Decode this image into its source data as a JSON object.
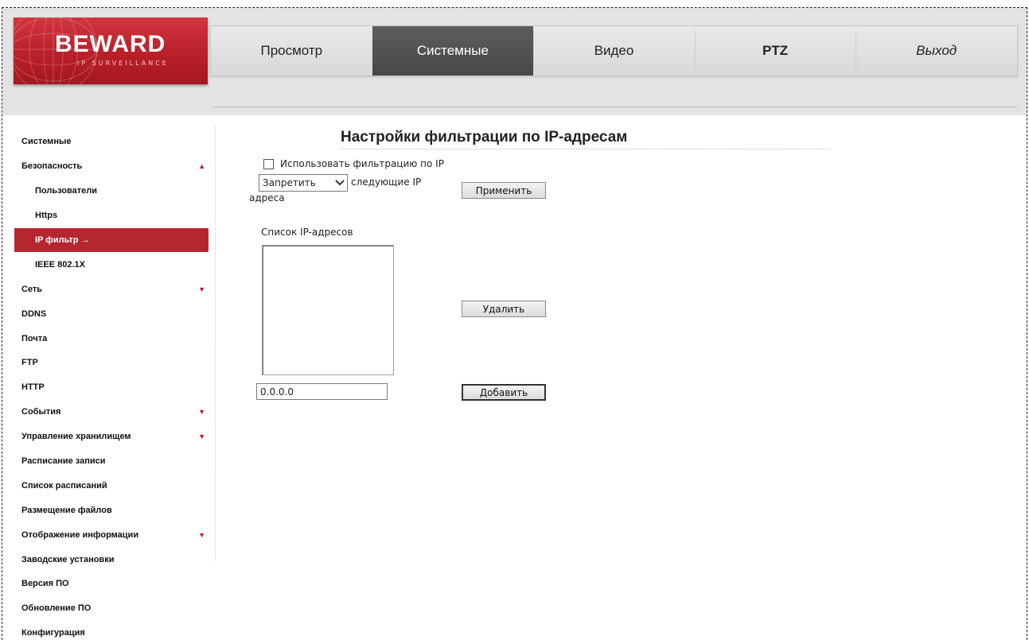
{
  "brand": {
    "name": "BEWARD",
    "tagline": "IP SURVEILLANCE"
  },
  "nav": {
    "items": [
      {
        "label": "Просмотр"
      },
      {
        "label": "Системные",
        "active": true
      },
      {
        "label": "Видео"
      },
      {
        "label": "PTZ"
      },
      {
        "label": "Выход"
      }
    ]
  },
  "sidebar": {
    "items": [
      {
        "label": "Системные"
      },
      {
        "label": "Безопасность",
        "arrow": "▲"
      },
      {
        "label": "Пользователи",
        "sub": true
      },
      {
        "label": "Https",
        "sub": true
      },
      {
        "label": "IP фильтр →",
        "sub": true,
        "active": true
      },
      {
        "label": "IEEE 802.1X",
        "sub": true
      },
      {
        "label": "Сеть",
        "arrow": "▼"
      },
      {
        "label": "DDNS"
      },
      {
        "label": "Почта"
      },
      {
        "label": "FTP"
      },
      {
        "label": "HTTP"
      },
      {
        "label": "События",
        "arrow": "▼"
      },
      {
        "label": "Управление хранилищем",
        "arrow": "▼"
      },
      {
        "label": "Расписание записи"
      },
      {
        "label": "Список расписаний"
      },
      {
        "label": "Размещение файлов"
      },
      {
        "label": "Отображение информации",
        "arrow": "▼"
      },
      {
        "label": "Заводские установки"
      },
      {
        "label": "Версия ПО"
      },
      {
        "label": "Обновление ПО"
      },
      {
        "label": "Конфигурация"
      }
    ]
  },
  "content": {
    "title": "Настройки фильтрации по IP-адресам",
    "use_filter_label": "Использовать фильтрацию по IP",
    "use_filter_checked": false,
    "mode_select_value": "Запретить",
    "following_ip_label": "следующие IP",
    "addresses_label": "адреса",
    "apply_button": "Применить",
    "list_label": "Список IP-адресов",
    "ip_list": [],
    "delete_button": "Удалить",
    "ip_input_value": "0.0.0.0",
    "add_button": "Добавить"
  },
  "colors": {
    "brand_red": "#b5262f",
    "nav_active": "#4f4f4f",
    "header_bg": "#e3e3e3"
  }
}
